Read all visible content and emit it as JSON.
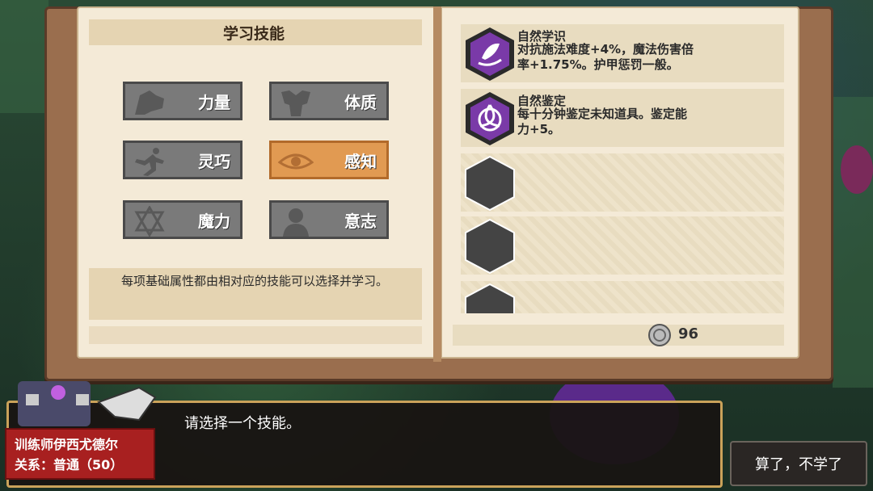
{
  "panel": {
    "title": "学习技能",
    "attributes": [
      {
        "label": "力量",
        "icon": "muscle-arm-icon",
        "selected": false
      },
      {
        "label": "体质",
        "icon": "body-torso-icon",
        "selected": false
      },
      {
        "label": "灵巧",
        "icon": "running-figure-icon",
        "selected": false
      },
      {
        "label": "感知",
        "icon": "eye-icon",
        "selected": true
      },
      {
        "label": "魔力",
        "icon": "hexagram-star-icon",
        "selected": false
      },
      {
        "label": "意志",
        "icon": "head-silhouette-icon",
        "selected": false
      }
    ],
    "description": "每项基础属性都由相对应的技能可以选择并学习。"
  },
  "skills": [
    {
      "name": "自然学识",
      "desc_line1": "对抗施法难度+4%，魔法伤害倍",
      "desc_line2": "率+1.75%。护甲惩罚一般。",
      "icon": "leaf-wind-icon"
    },
    {
      "name": "自然鉴定",
      "desc_line1": "每十分钟鉴定未知道具。鉴定能",
      "desc_line2": "力+5。",
      "icon": "triquetra-icon"
    }
  ],
  "currency": {
    "value": "96",
    "icon": "silver-coin-icon"
  },
  "dialog": {
    "text": "请选择一个技能。",
    "npc_name": "训练师伊西尤德尔",
    "relation": "关系：普通（50）"
  },
  "cancel_button": "算了，不学了",
  "colors": {
    "selected_attr": "#e19a52",
    "attr_button": "#7a7a7a",
    "npc_tag": "#a82020",
    "skill_icon": "#7a3aa8"
  }
}
